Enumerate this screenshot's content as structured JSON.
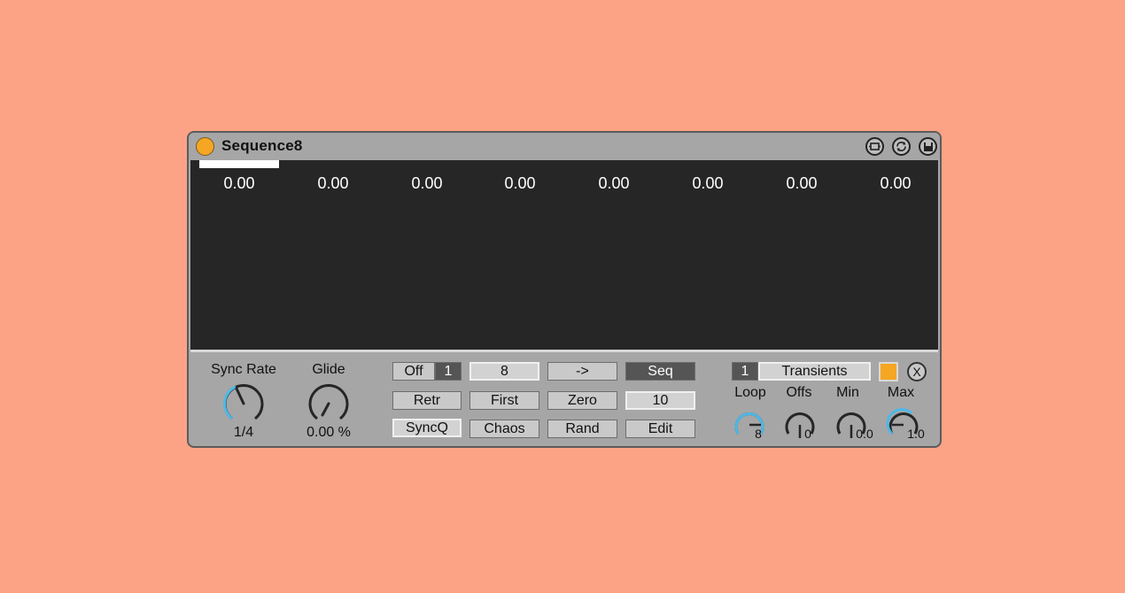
{
  "device": {
    "title": "Sequence8",
    "step_values": [
      "0.00",
      "0.00",
      "0.00",
      "0.00",
      "0.00",
      "0.00",
      "0.00",
      "0.00"
    ]
  },
  "controls": {
    "sync_rate": {
      "label": "Sync Rate",
      "value": "1/4"
    },
    "glide": {
      "label": "Glide",
      "value": "0.00 %"
    }
  },
  "buttons": {
    "off": "Off",
    "off_num": "1",
    "steps": "8",
    "arrow": "->",
    "seq": "Seq",
    "retr": "Retr",
    "first": "First",
    "zero": "Zero",
    "ten": "10",
    "syncq": "SyncQ",
    "chaos": "Chaos",
    "rand": "Rand",
    "edit": "Edit"
  },
  "right_panel": {
    "transients_num": "1",
    "transients": "Transients",
    "x": "X",
    "loop": {
      "label": "Loop",
      "value": "8"
    },
    "offs": {
      "label": "Offs",
      "value": "0"
    },
    "min": {
      "label": "Min",
      "value": "0.0"
    },
    "max": {
      "label": "Max",
      "value": "1.0"
    }
  },
  "colors": {
    "background": "#fda385",
    "accent": "#f5a623",
    "knob_blue": "#4db8e8"
  }
}
